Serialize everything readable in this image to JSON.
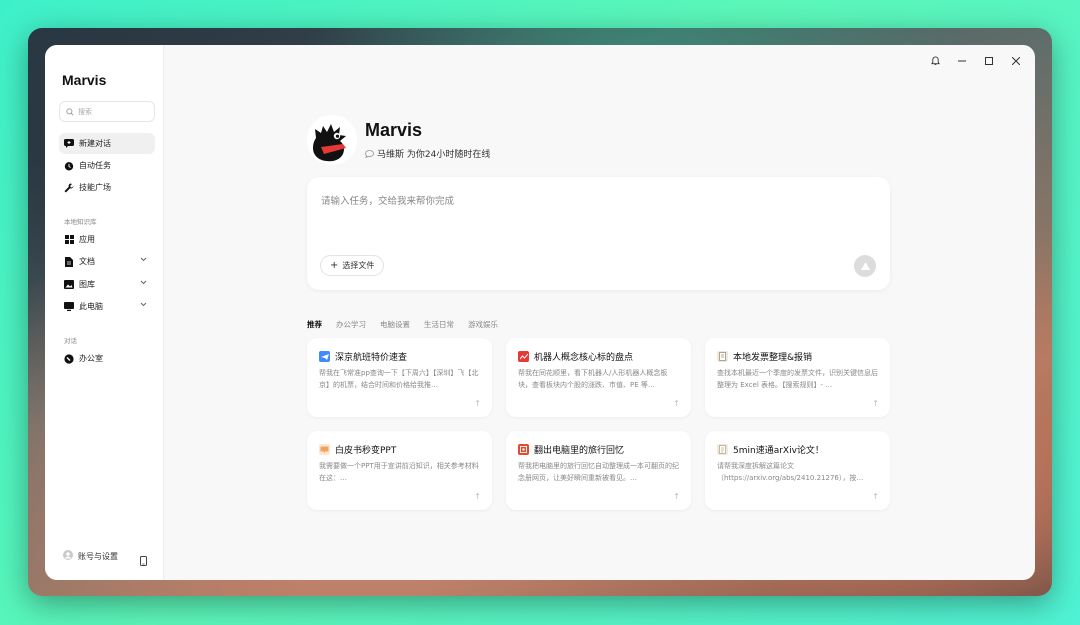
{
  "window": {
    "controls": [
      "bell-icon",
      "minimize-icon",
      "maximize-icon",
      "close-icon"
    ]
  },
  "sidebar": {
    "brand": "Marvis",
    "search_placeholder": "搜索",
    "items": [
      {
        "label": "新建对话",
        "icon": "chat-icon",
        "active": true
      },
      {
        "label": "自动任务",
        "icon": "clock-icon"
      },
      {
        "label": "技能广场",
        "icon": "wrench-icon"
      }
    ],
    "knowledge_title": "本地知识库",
    "knowledge_items": [
      {
        "label": "应用",
        "icon": "apps-icon"
      },
      {
        "label": "文档",
        "icon": "document-icon"
      },
      {
        "label": "图库",
        "icon": "image-icon"
      },
      {
        "label": "此电脑",
        "icon": "monitor-icon"
      }
    ],
    "chat_title": "对话",
    "chat_items": [
      {
        "label": "办公室",
        "icon": "office-icon"
      }
    ],
    "account_label": "账号与设置"
  },
  "profile": {
    "name": "Marvis",
    "tagline": "马维斯 为你24小时随时在线"
  },
  "input": {
    "placeholder": "请输入任务，交给我来帮你完成",
    "file_button": "选择文件",
    "file_plus": "+"
  },
  "tabs": [
    "推荐",
    "办公学习",
    "电脑设置",
    "生活日常",
    "游戏娱乐"
  ],
  "cards": [
    {
      "title": "深京航班特价速查",
      "desc": "帮我在飞常准pp查询一下【下周六】【深圳】飞【北京】的机票，结合时间和价格给我推…",
      "color": "#3d8bff"
    },
    {
      "title": "机器人概念核心标的盘点",
      "desc": "帮我在同花顺里，看下机器人/人形机器人概念板块，查看板块内个股的涨跌、市值、PE 等…",
      "color": "#e53935"
    },
    {
      "title": "本地发票整理&报销",
      "desc": "查找本机最近一个季度的发票文件，识别关键信息后整理为 Excel 表格。【搜索规则】- …",
      "color": "#9e8f7a"
    },
    {
      "title": "白皮书秒变PPT",
      "desc": "我需要做一个PPT用于宣讲前沿知识，相关参考材料在这：…",
      "color": "#f0a35e"
    },
    {
      "title": "翻出电脑里的旅行回忆",
      "desc": "帮我把电脑里的旅行回忆自动整理成一本可翻页的纪念册网页，让美好瞬间重新被看见。…",
      "color": "#e64a2e"
    },
    {
      "title": "5min速通arXiv论文！",
      "desc": "请帮我深度拆解这篇论文（https://arxiv.org/abs/2410.21276），按…",
      "color": "#b9a988"
    }
  ],
  "colors": {
    "accent_red": "#e53935",
    "bg": "#f8f8f9"
  }
}
